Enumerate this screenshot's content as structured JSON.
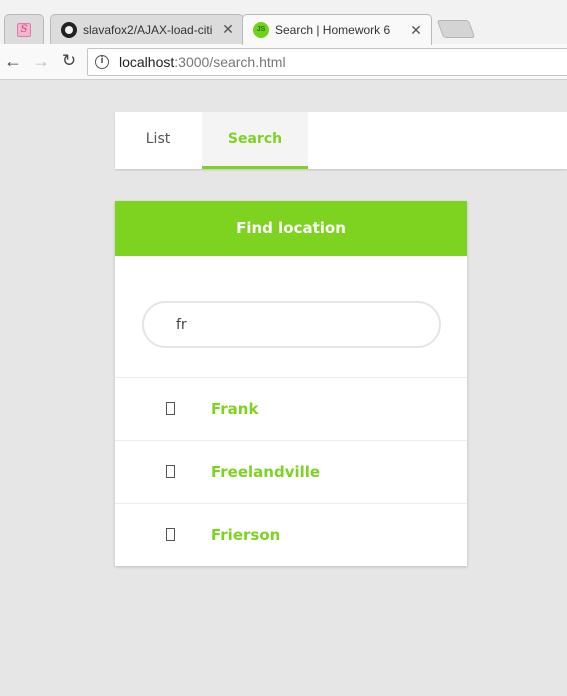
{
  "browser": {
    "tabs": [
      {
        "title": "",
        "favicon": "pinned-app-icon"
      },
      {
        "title": "slavafox2/AJAX-load-citi",
        "favicon": "github-icon"
      },
      {
        "title": "Search | Homework 6",
        "favicon": "js-icon"
      }
    ],
    "close_glyph": "✕",
    "address": {
      "host": "localhost",
      "rest": ":3000/search.html"
    }
  },
  "nav": {
    "tabs": [
      {
        "label": "List",
        "active": false
      },
      {
        "label": "Search",
        "active": true
      }
    ]
  },
  "search_card": {
    "title": "Find location",
    "input_value": "fr",
    "results": [
      "Frank",
      "Freelandville",
      "Frierson"
    ]
  },
  "colors": {
    "accent": "#7ed321",
    "background": "#e6e6e6"
  }
}
